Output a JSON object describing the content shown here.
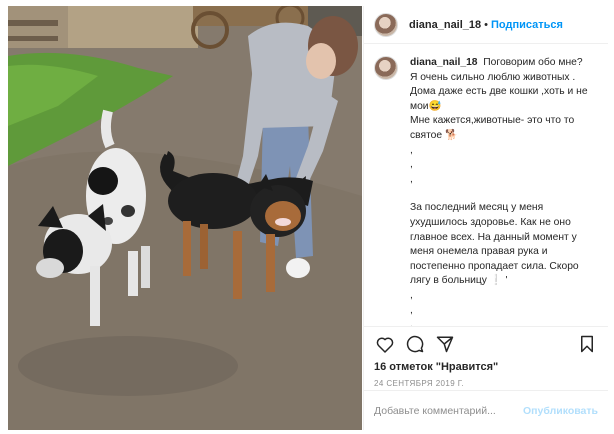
{
  "post": {
    "username": "diana_nail_18",
    "dot": "•",
    "follow_label": "Подписаться",
    "more_label": "···",
    "caption_lines": [
      "Поговорим обо мне?",
      "Я очень сильно люблю животных .",
      "Дома даже есть две кошки ,хоть и не",
      "мои😅",
      "Мне кажется,животные- это что то",
      "святое 🐕",
      ",",
      ",",
      ",",
      "",
      "За последний месяц у меня",
      "ухудшилось здоровье. Как не оно",
      "главное всех. На данный момент у",
      "меня онемела правая рука и",
      "постепенно пропадает сила. Скоро",
      "лягу в больницу ❕ '",
      ",",
      ",",
      ","
    ],
    "likes_text": "16 отметок \"Нравится\"",
    "date_text": "24 СЕНТЯБРЯ 2019 Г.",
    "comment_placeholder": "Добавьте комментарий...",
    "publish_label": "Опубликовать",
    "icons": [
      "heart-icon",
      "comment-icon",
      "share-icon",
      "bookmark-icon"
    ]
  },
  "colors": {
    "link_blue": "#0095f6",
    "publish_disabled": "#b2dffc",
    "muted": "#8e8e8e",
    "text": "#262626"
  }
}
